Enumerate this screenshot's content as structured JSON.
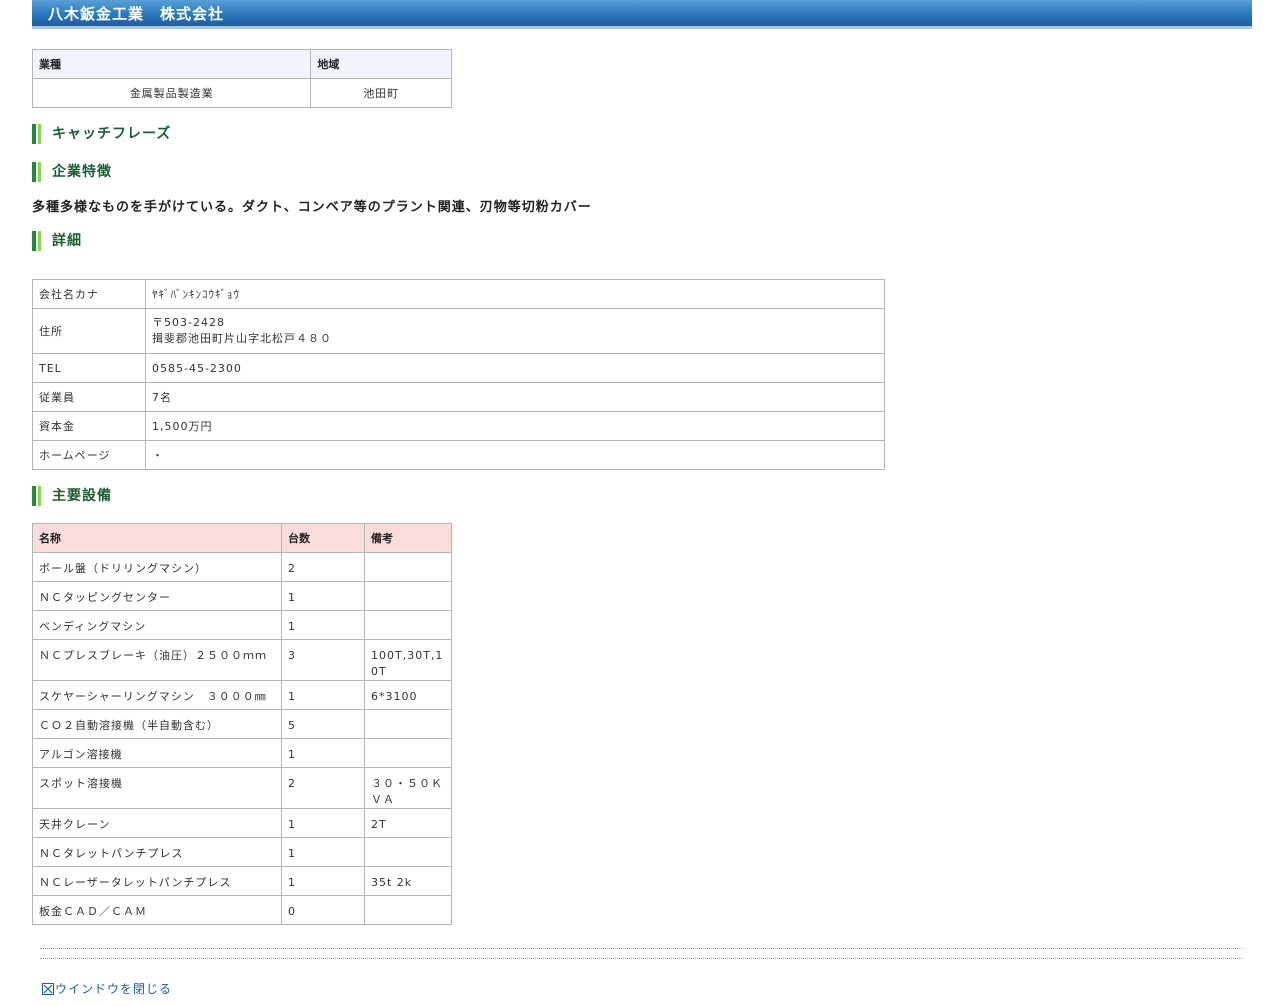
{
  "company": {
    "name": "八木鈑金工業　株式会社"
  },
  "basic": {
    "headers": [
      "業種",
      "地域"
    ],
    "values": [
      "金属製品製造業",
      "池田町"
    ]
  },
  "sections": {
    "catchphrase": "キャッチフレーズ",
    "feature": "企業特徴",
    "detail": "詳細",
    "equipment": "主要設備"
  },
  "feature_text": "多種多様なものを手がけている。ダクト、コンベア等のプラント関連、刃物等切粉カバー",
  "detail": {
    "rows": [
      {
        "label": "会社名カナ",
        "value": "ﾔｷﾞﾊﾞﾝｷﾝｺｳｷﾞｮｳ"
      },
      {
        "label": "住所",
        "value_line1": "〒503-2428",
        "value_line2": "揖斐郡池田町片山字北松戸４８０"
      },
      {
        "label": "TEL",
        "value": "0585-45-2300"
      },
      {
        "label": "従業員",
        "value": "7名"
      },
      {
        "label": "資本金",
        "value": "1,500万円"
      },
      {
        "label": "ホームページ",
        "value": "・"
      }
    ]
  },
  "equipment": {
    "headers": [
      "名称",
      "台数",
      "備考"
    ],
    "rows": [
      [
        "ボール盤（ドリリングマシン）",
        "2",
        ""
      ],
      [
        "ＮＣタッピングセンター",
        "1",
        ""
      ],
      [
        "ベンディングマシン",
        "1",
        ""
      ],
      [
        "ＮＣプレスブレーキ（油圧）２５００ｍｍ",
        "3",
        "100T,30T,10T"
      ],
      [
        "スケヤーシャーリングマシン　３０００㎜",
        "1",
        "6*3100"
      ],
      [
        "ＣＯ２自動溶接機（半自動含む）",
        "5",
        ""
      ],
      [
        "アルゴン溶接機",
        "1",
        ""
      ],
      [
        "スポット溶接機",
        "2",
        "３０・５０ＫＶＡ"
      ],
      [
        "天井クレーン",
        "1",
        "2T"
      ],
      [
        "ＮＣタレットパンチプレス",
        "1",
        ""
      ],
      [
        "ＮＣレーザータレットパンチプレス",
        "1",
        "35t 2k"
      ],
      [
        "板金ＣＡＤ／ＣＡＭ",
        "0",
        ""
      ]
    ]
  },
  "close_link": "ウインドウを閉じる",
  "colors": {
    "title_bar": "#2f7bc0",
    "heading_green": "#1b5e34",
    "equip_header": "#fbdcdc",
    "basic_header": "#eff5fa"
  }
}
